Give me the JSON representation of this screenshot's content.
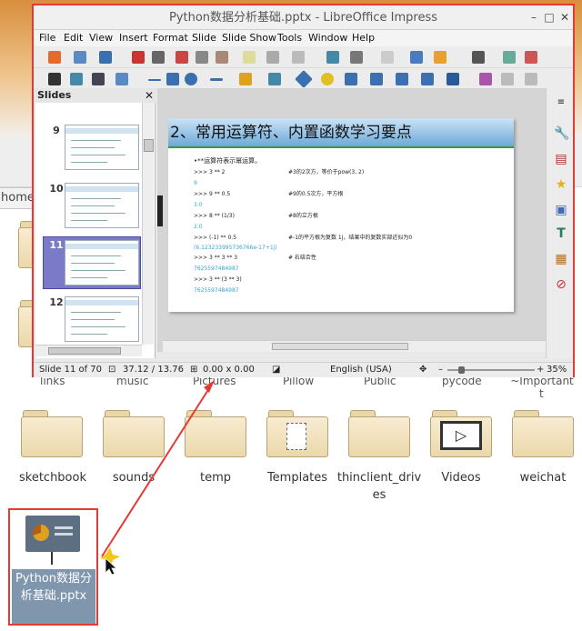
{
  "window": {
    "title": "Python数据分析基础.pptx - LibreOffice Impress",
    "menus": [
      "File",
      "Edit",
      "View",
      "Insert",
      "Format",
      "Slide",
      "Slide Show",
      "Tools",
      "Window",
      "Help"
    ]
  },
  "slides_pane": {
    "header": "Slides",
    "thumbs": [
      {
        "num": "9"
      },
      {
        "num": "10"
      },
      {
        "num": "11"
      },
      {
        "num": "12"
      }
    ]
  },
  "slide": {
    "title": "2、常用运算符、内置函数学习要点",
    "bullet": "**运算符表示幂运算。",
    "lines": [
      {
        "code": ">>> 3 ** 2",
        "comment": "#3的2次方，等价于pow(3, 2)"
      },
      {
        "out": "9"
      },
      {
        "code": ">>> 9 ** 0.5",
        "comment": "#9的0.5次方，平方根"
      },
      {
        "out": "3.0"
      },
      {
        "code": ">>> 8 ** (1/3)",
        "comment": "#8的立方根"
      },
      {
        "out": "2.0"
      },
      {
        "code": ">>> (-1) ** 0.5",
        "comment": "#-1的平方根为复数 1j，结果中的复数实部近似为0"
      },
      {
        "out": "(6.123233995736766e-17+1j)"
      },
      {
        "code": ">>> 3 ** 3 ** 3",
        "comment": "# 右结合性"
      },
      {
        "out": "7625597484987"
      },
      {
        "code": ">>> 3 ** (3 ** 3)",
        "comment": ""
      },
      {
        "out": "7625597484987"
      }
    ]
  },
  "status": {
    "slide": "Slide 11 of 70",
    "position": "37.12 / 13.76",
    "size": "0.00 x 0.00",
    "language": "English (USA)",
    "zoom": "35%"
  },
  "file_manager": {
    "breadcrumb": "home",
    "cut_labels": [
      "links",
      "music",
      "Pictures",
      "Pillow",
      "Public",
      "pycode",
      "~​t"
    ],
    "folders": [
      {
        "name": "sketchbook"
      },
      {
        "name": "sounds"
      },
      {
        "name": "temp"
      },
      {
        "name": "Templates"
      },
      {
        "name": "thinclient_drives"
      },
      {
        "name": "Videos"
      },
      {
        "name": "weichat"
      }
    ],
    "selected_file": "Python数据分析基础.pptx"
  }
}
